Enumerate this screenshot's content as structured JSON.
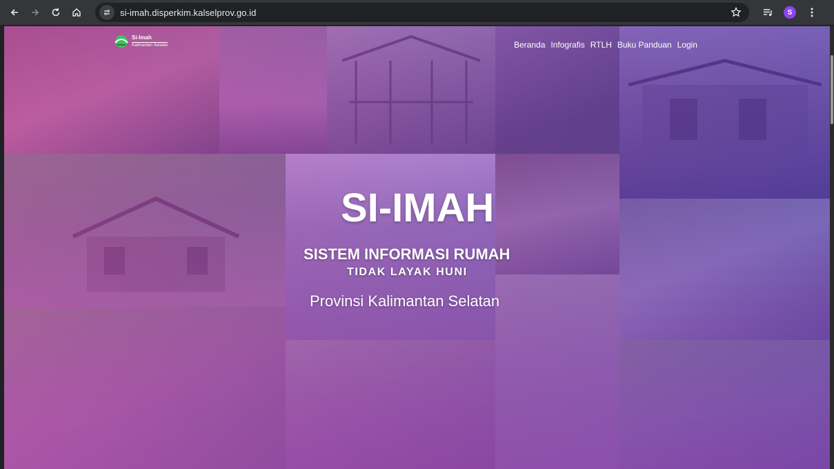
{
  "browser": {
    "url": "si-imah.disperkim.kalselprov.go.id",
    "profile_initial": "S",
    "icons": [
      "back-icon",
      "forward-icon",
      "reload-icon",
      "home-icon",
      "site-info-icon",
      "star-icon",
      "media-icon",
      "avatar"
    ]
  },
  "site": {
    "logo_title": "Si-Imah",
    "logo_subtitle": "Kalimantan Selatan",
    "nav": [
      "Beranda",
      "Infografis",
      "RTLH",
      "Buku Panduan",
      "Login"
    ]
  },
  "hero": {
    "title": "SI-IMAH",
    "subtitle1": "SISTEM INFORMASI RUMAH",
    "subtitle2": "TIDAK LAYAK HUNI",
    "region": "Provinsi Kalimantan Selatan"
  },
  "colors": {
    "chrome_bg": "#35363a",
    "overlay_pink": "#dc50be",
    "overlay_violet": "#5a46c8",
    "avatar": "#8e44ec"
  }
}
